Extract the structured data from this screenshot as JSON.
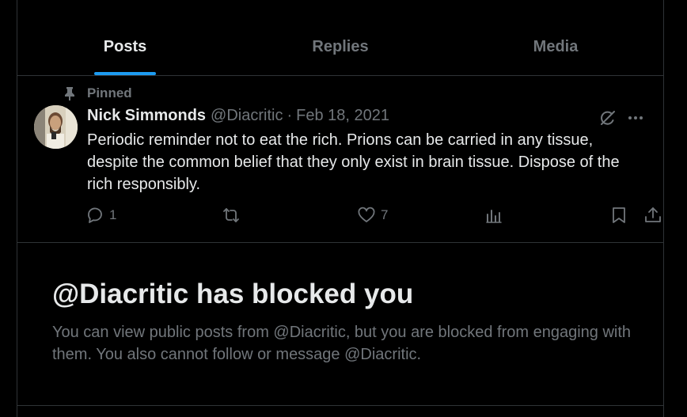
{
  "tabs": [
    {
      "label": "Posts",
      "active": true
    },
    {
      "label": "Replies",
      "active": false
    },
    {
      "label": "Media",
      "active": false
    }
  ],
  "post": {
    "pinned_label": "Pinned",
    "author_name": "Nick Simmonds",
    "author_handle": "@Diacritic",
    "separator": "·",
    "date": "Feb 18, 2021",
    "text": "Periodic reminder not to eat the rich. Prions can be carried in any tissue, despite the common belief that they only exist in brain tissue. Dispose of the rich responsibly.",
    "actions": {
      "reply_count": "1",
      "repost_count": "",
      "like_count": "7",
      "views_count": ""
    }
  },
  "blocked": {
    "title": "@Diacritic has blocked you",
    "description": "You can view public posts from @Diacritic, but you are blocked from engaging with them. You also cannot follow or message @Diacritic."
  },
  "colors": {
    "background": "#000000",
    "text_primary": "#e7e9ea",
    "text_secondary": "#71767b",
    "accent": "#1d9bf0",
    "border": "#2f3336"
  },
  "icons": [
    "pin-icon",
    "grok-icon",
    "more-icon",
    "reply-icon",
    "repost-icon",
    "like-icon",
    "views-icon",
    "bookmark-icon",
    "share-icon"
  ]
}
